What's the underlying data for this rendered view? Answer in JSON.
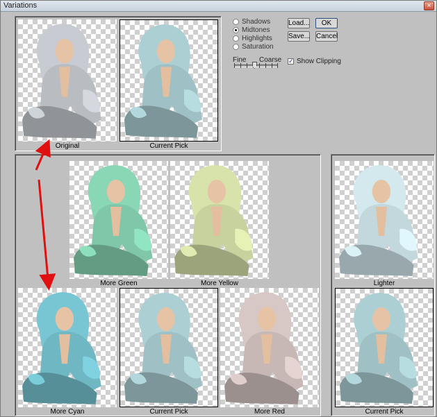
{
  "window": {
    "title": "Variations",
    "close_glyph": "×"
  },
  "options": {
    "tones": [
      {
        "label": "Shadows",
        "selected": false
      },
      {
        "label": "Midtones",
        "selected": true
      },
      {
        "label": "Highlights",
        "selected": false
      },
      {
        "label": "Saturation",
        "selected": false
      }
    ],
    "slider": {
      "fine_label": "Fine",
      "coarse_label": "Coarse"
    },
    "show_clipping": {
      "label": "Show Clipping",
      "checked": true,
      "check_glyph": "✓"
    }
  },
  "buttons": {
    "load": "Load...",
    "save": "Save...",
    "ok": "OK",
    "cancel": "Cancel"
  },
  "previews": {
    "original": "Original",
    "current_pick_top": "Current Pick",
    "more_green": "More Green",
    "more_yellow": "More Yellow",
    "more_cyan": "More Cyan",
    "current_pick_center": "Current Pick",
    "more_red": "More Red",
    "lighter": "Lighter",
    "current_pick_right": "Current Pick"
  },
  "colors": {
    "original": "#b9bdc2",
    "current_pick": "#9fc0c4",
    "more_green": "#7fc7a8",
    "more_yellow": "#c8d29e",
    "more_cyan": "#6fb7c3",
    "more_red": "#c7b8b6",
    "lighter": "#c3d8dc",
    "arrow": "#e01010"
  }
}
